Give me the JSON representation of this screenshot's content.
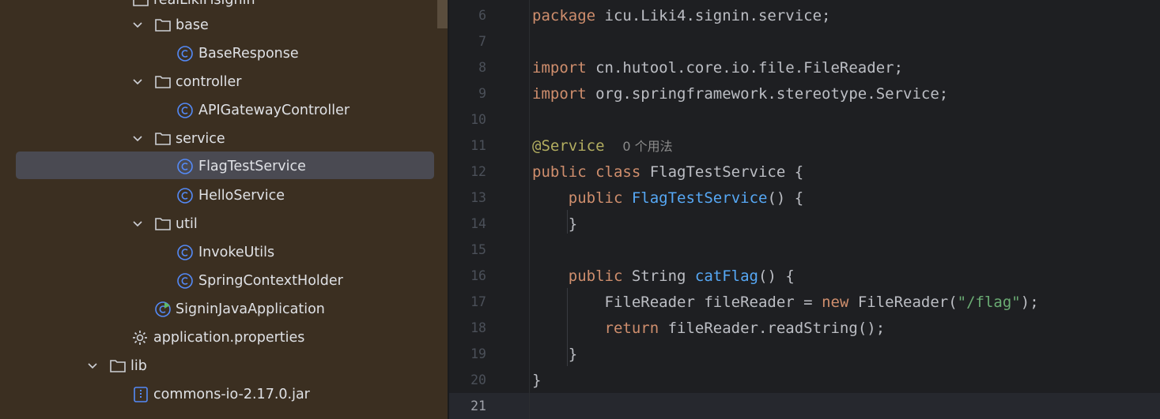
{
  "tree": {
    "top_partial_label": "realLikiFisignin",
    "items": [
      {
        "label": "base",
        "type": "folder",
        "expanded": true
      },
      {
        "label": "BaseResponse",
        "type": "class"
      },
      {
        "label": "controller",
        "type": "folder",
        "expanded": true
      },
      {
        "label": "APIGatewayController",
        "type": "class"
      },
      {
        "label": "service",
        "type": "folder",
        "expanded": true
      },
      {
        "label": "FlagTestService",
        "type": "class",
        "selected": true
      },
      {
        "label": "HelloService",
        "type": "class"
      },
      {
        "label": "util",
        "type": "folder",
        "expanded": true
      },
      {
        "label": "InvokeUtils",
        "type": "class"
      },
      {
        "label": "SpringContextHolder",
        "type": "class"
      },
      {
        "label": "SigninJavaApplication",
        "type": "run-class"
      },
      {
        "label": "application.properties",
        "type": "properties"
      },
      {
        "label": "lib",
        "type": "folder",
        "expanded": true
      },
      {
        "label": "commons-io-2.17.0.jar",
        "type": "jar"
      }
    ]
  },
  "editor": {
    "lines": [
      {
        "n": "6"
      },
      {
        "n": "7"
      },
      {
        "n": "8"
      },
      {
        "n": "9"
      },
      {
        "n": "10"
      },
      {
        "n": "11"
      },
      {
        "n": "12"
      },
      {
        "n": "13"
      },
      {
        "n": "14"
      },
      {
        "n": "15"
      },
      {
        "n": "16"
      },
      {
        "n": "17"
      },
      {
        "n": "18"
      },
      {
        "n": "19"
      },
      {
        "n": "20"
      },
      {
        "n": "21"
      }
    ],
    "code": {
      "l6_kw": "package",
      "l6_rest": " icu.Liki4.signin.service;",
      "l8_kw": "import",
      "l8_rest": " cn.hutool.core.io.file.FileReader;",
      "l9_kw": "import",
      "l9_rest": " org.springframework.stereotype.Service;",
      "l11_ann": "@Service",
      "l11_hint": "0 个用法",
      "l12_kw": "public class",
      "l12_rest": " FlagTestService {",
      "l13_kw": "public",
      "l13_fn": "FlagTestService",
      "l13_rest": "() {",
      "l14": "}",
      "l16_kw": "public",
      "l16_type": " String ",
      "l16_fn": "catFlag",
      "l16_rest": "() {",
      "l17_a": "FileReader fileReader = ",
      "l17_kw": "new",
      "l17_b": " FileReader(",
      "l17_str": "\"/flag\"",
      "l17_c": ");",
      "l18_kw": "return",
      "l18_rest": " fileReader.readString();",
      "l19": "}",
      "l20": "}"
    }
  }
}
